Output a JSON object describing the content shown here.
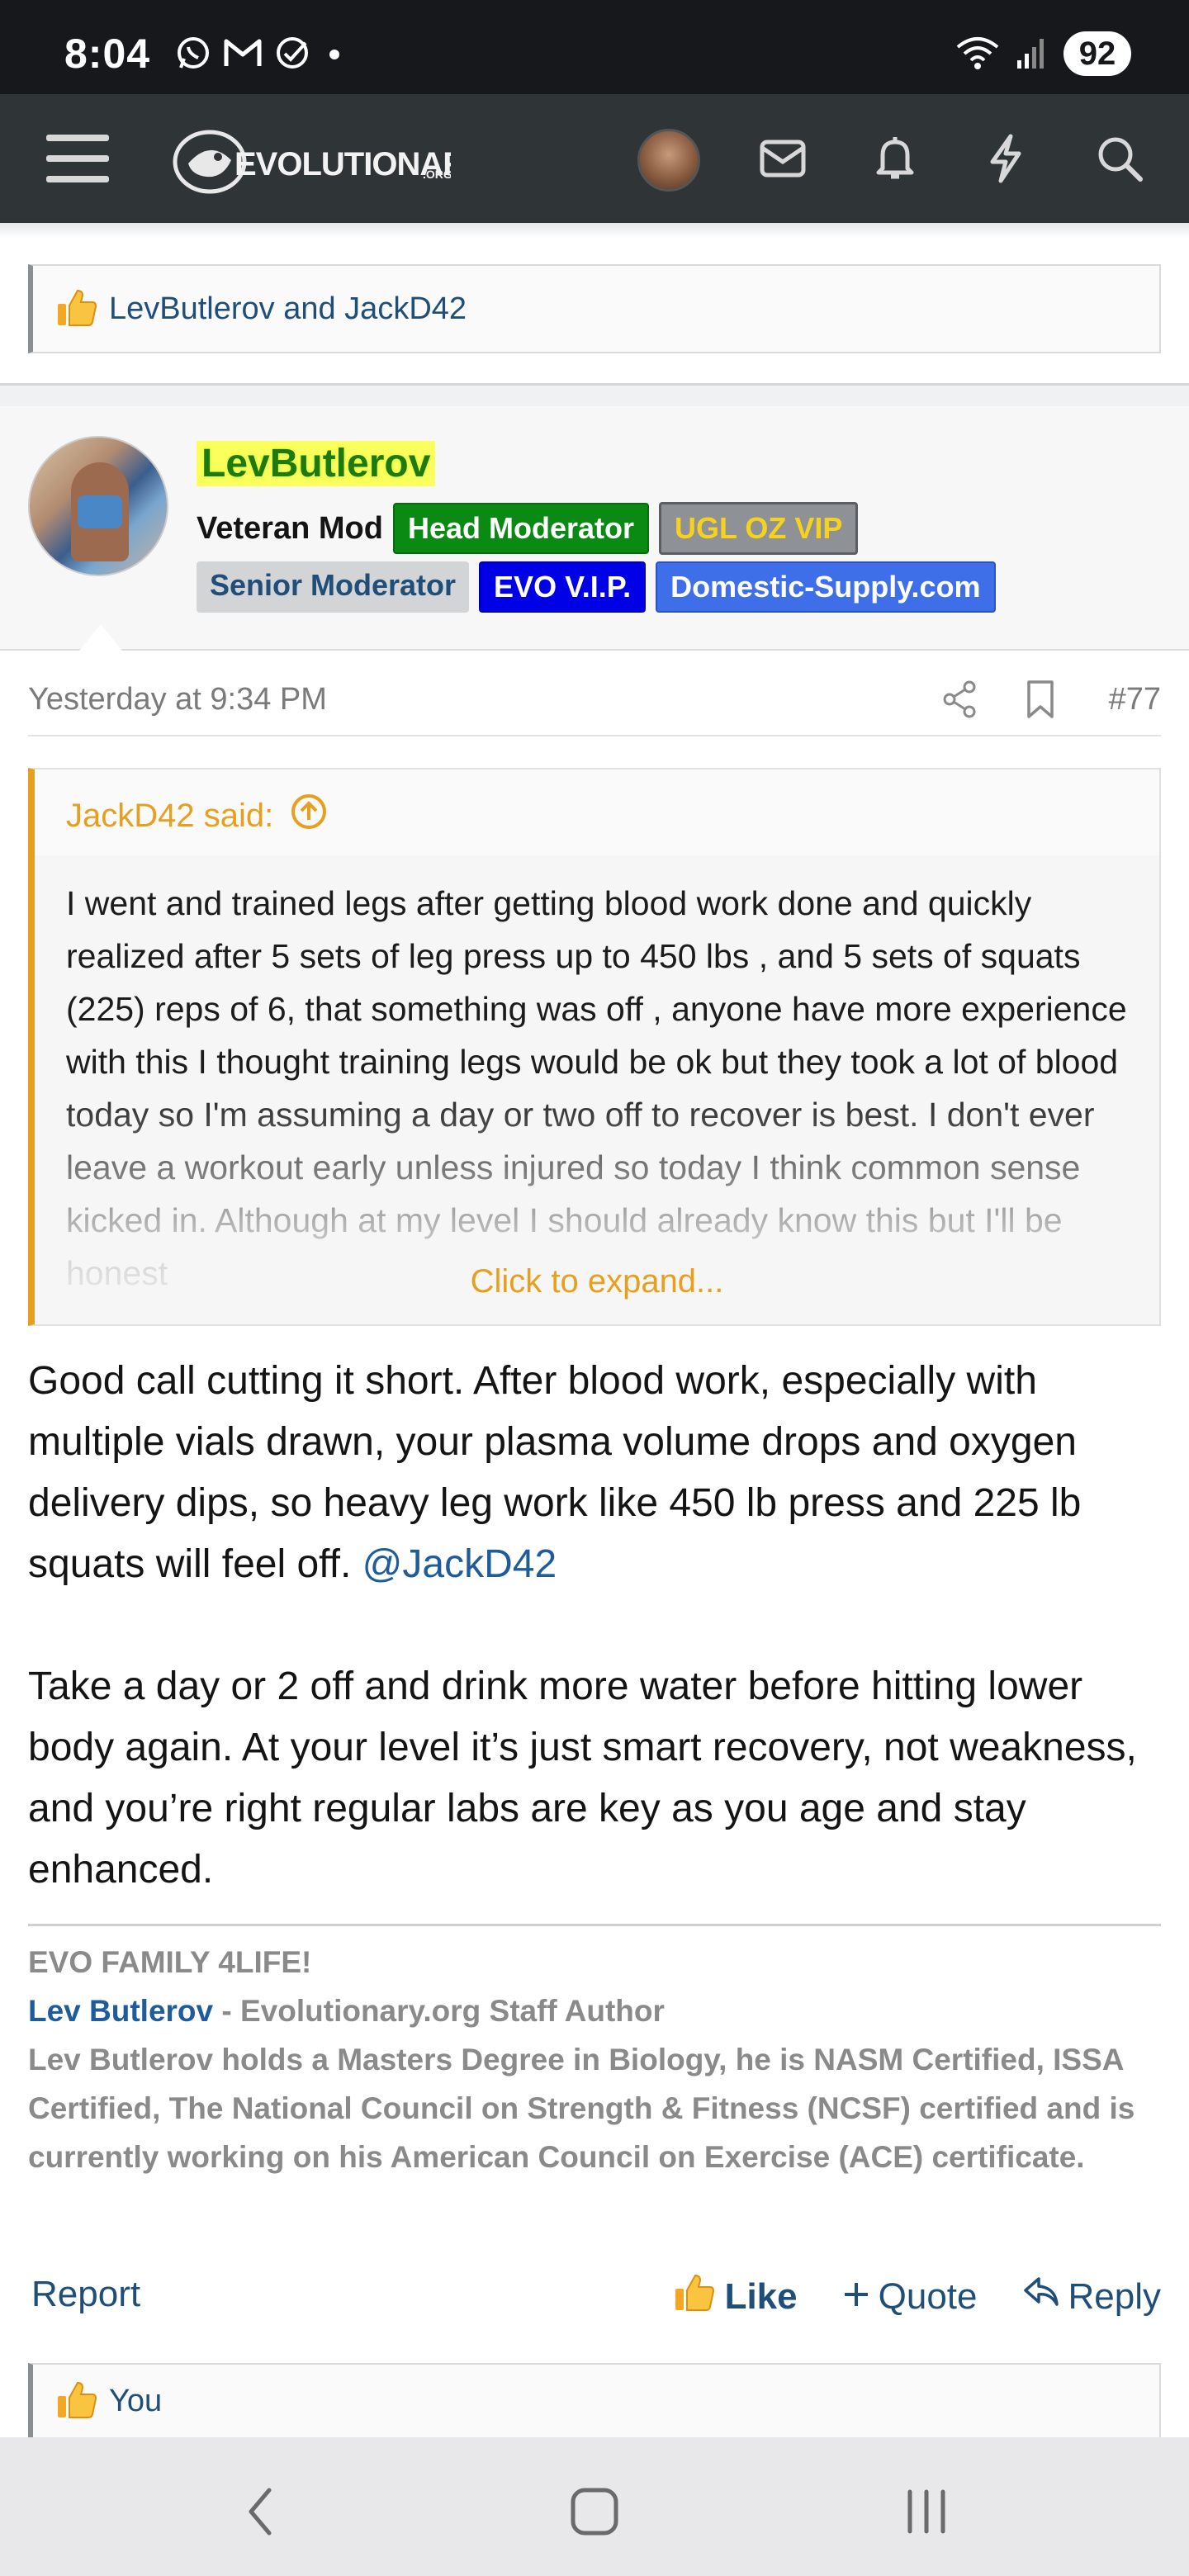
{
  "status_bar": {
    "time": "8:04",
    "battery": "92",
    "icons": [
      "whatsapp-icon",
      "gmail-icon",
      "check-circle-icon",
      "dot-icon",
      "wifi-icon",
      "signal-icon"
    ]
  },
  "navbar": {
    "logo_text": "EVOLUTIONARY",
    "logo_suffix": ".ORG",
    "icons": [
      "menu-icon",
      "avatar",
      "inbox-icon",
      "bell-icon",
      "bolt-icon",
      "search-icon"
    ]
  },
  "reactions_top": {
    "text": "LevButlerov and JackD42"
  },
  "post": {
    "username": "LevButlerov",
    "user_title": "Veteran Mod",
    "banners": [
      "Head Moderator",
      "UGL OZ VIP",
      "Senior Moderator",
      "EVO V.I.P.",
      "Domestic-Supply.com"
    ],
    "date": "Yesterday at 9:34 PM",
    "post_number": "#77",
    "quote": {
      "author": "JackD42 said:",
      "body": "I went and trained legs after getting blood work done and quickly realized after 5 sets of leg press up to 450 lbs , and 5 sets of squats (225) reps of 6, that something was off , anyone have more experience with this I thought training legs would be ok but they took a lot of blood today so I'm assuming a day or two off to recover is best. I don't ever leave a workout early unless injured so today I think common sense kicked in. Although at my level I should already know this but I'll be honest",
      "expand_label": "Click to expand..."
    },
    "body_p1": "Good call cutting it short. After blood work, especially with multiple vials drawn, your plasma volume drops and oxygen delivery dips, so heavy leg work like 450 lb press and 225 lb squats will feel off.",
    "mention": "@JackD42",
    "body_p2": "Take a day or 2 off and drink more water before hitting lower body again. At your level it’s just smart recovery, not weakness, and you’re right regular labs are key as you age and stay enhanced.",
    "signature": {
      "line1": "EVO FAMILY 4LIFE!",
      "name": "Lev Butlerov",
      "role": " - Evolutionary.org Staff Author",
      "bio": "Lev Butlerov holds a Masters Degree in Biology, he is NASM Certified, ISSA Certified, The National Council on Strength & Fitness (NCSF) certified and is currently working on his American Council on Exercise (ACE) certificate."
    },
    "actions": {
      "report": "Report",
      "like": "Like",
      "quote": "Quote",
      "reply": "Reply"
    }
  },
  "reactions_bottom": {
    "text": "You"
  },
  "colors": {
    "navbar_bg": "#2f3437",
    "link": "#1f4e79",
    "quote_accent": "#e6a01e",
    "username": "#1e7a0c",
    "head_mod_badge": "#0a8a12",
    "evo_vip_badge": "#0000e6",
    "domestic_badge": "#3f6fe8"
  }
}
